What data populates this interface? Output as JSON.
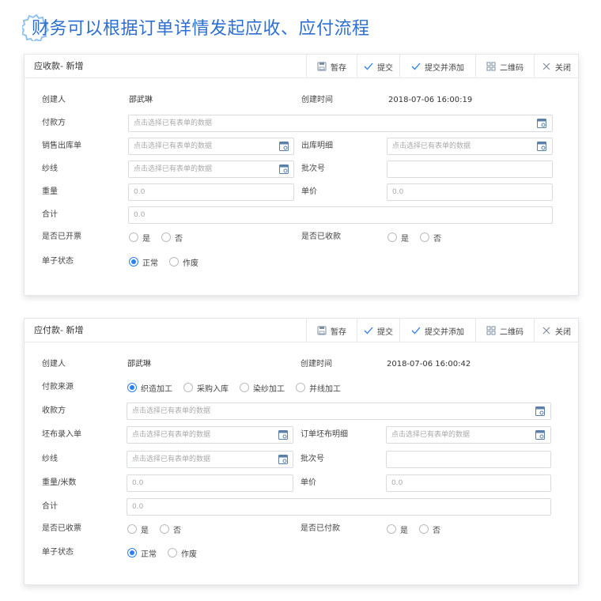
{
  "heading": {
    "text": "财务可以根据订单详情发起应收、应付流程"
  },
  "toolbar": {
    "save_label": "暂存",
    "submit_label": "提交",
    "submit_add_label": "提交并添加",
    "qr_label": "二维码",
    "close_label": "关闭"
  },
  "picker_placeholder": "点击选择已有表单的数据",
  "receivable": {
    "title": "应收款- 新增",
    "creator_label": "创建人",
    "creator_value": "邵武琳",
    "created_time_label": "创建时间",
    "created_time_value": "2018-07-06 16:00:19",
    "payer_label": "付款方",
    "sales_outbound_label": "销售出库单",
    "outbound_detail_label": "出库明细",
    "yarn_label": "纱线",
    "batch_label": "批次号",
    "batch_value": "",
    "weight_label": "重量",
    "weight_placeholder": "0.0",
    "unit_price_label": "单价",
    "unit_price_placeholder": "0.0",
    "total_label": "合计",
    "total_placeholder": "0.0",
    "invoiced_label": "是否已开票",
    "collected_label": "是否已收款",
    "yes": "是",
    "no": "否",
    "status_label": "单子状态",
    "status_normal": "正常",
    "status_void": "作废"
  },
  "payable": {
    "title": "应付款- 新增",
    "creator_label": "创建人",
    "creator_value": "邵武琳",
    "created_time_label": "创建时间",
    "created_time_value": "2018-07-06 16:00:42",
    "source_label": "付款来源",
    "source_options": [
      "织造加工",
      "采购入库",
      "染纱加工",
      "并线加工"
    ],
    "payee_label": "收款方",
    "greige_entry_label": "坯布录入单",
    "order_greige_detail_label": "订单坯布明细",
    "yarn_label": "纱线",
    "batch_label": "批次号",
    "batch_value": "",
    "weight_meters_label": "重量/米数",
    "weight_placeholder": "0.0",
    "unit_price_label": "单价",
    "unit_price_placeholder": "0.0",
    "total_label": "合计",
    "total_placeholder": "0.0",
    "invoice_received_label": "是否已收票",
    "paid_label": "是否已付款",
    "yes": "是",
    "no": "否",
    "status_label": "单子状态",
    "status_normal": "正常",
    "status_void": "作废"
  },
  "colors": {
    "accent": "#2d7ef0",
    "heading": "#2d6fd0",
    "border": "#d8dce0"
  },
  "icons": [
    "gear-badge-icon",
    "save-icon",
    "check-icon",
    "check-icon",
    "qr-code-icon",
    "close-icon",
    "picker-icon"
  ]
}
